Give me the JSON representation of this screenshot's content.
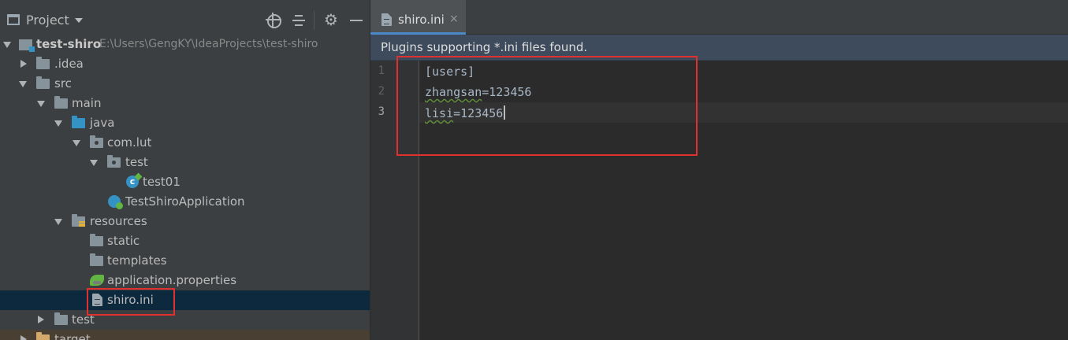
{
  "project_panel": {
    "title": "Project",
    "tree": [
      {
        "label": "test-shiro",
        "path": "E:\\Users\\GengKY\\IdeaProjects\\test-shiro"
      },
      {
        "label": ".idea"
      },
      {
        "label": "src"
      },
      {
        "label": "main"
      },
      {
        "label": "java"
      },
      {
        "label": "com.lut"
      },
      {
        "label": "test"
      },
      {
        "label": "test01"
      },
      {
        "label": "TestShiroApplication"
      },
      {
        "label": "resources"
      },
      {
        "label": "static"
      },
      {
        "label": "templates"
      },
      {
        "label": "application.properties"
      },
      {
        "label": "shiro.ini"
      },
      {
        "label": "test"
      },
      {
        "label": "target"
      }
    ]
  },
  "editor": {
    "tab_label": "shiro.ini",
    "tab_close": "×",
    "banner": "Plugins supporting *.ini files found.",
    "line_numbers": [
      "1",
      "2",
      "3"
    ],
    "lines": [
      {
        "text": "[users]"
      },
      {
        "key": "zhangsan",
        "rest": "=123456"
      },
      {
        "key": "lisi",
        "rest": "=123456"
      }
    ]
  },
  "colors": {
    "annotation": "#e03030",
    "selection": "#0d293e",
    "accent": "#4a88c7"
  }
}
